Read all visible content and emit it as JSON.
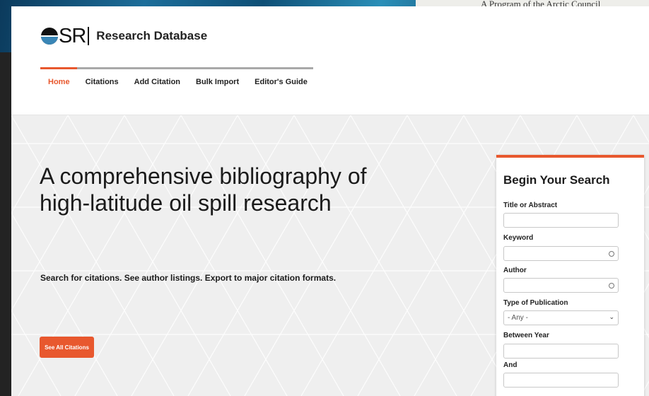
{
  "banner": {
    "tagline": "A Program of the Arctic Council"
  },
  "header": {
    "logo_text": "SR",
    "site_name": "Research Database"
  },
  "nav": {
    "items": [
      "Home",
      "Citations",
      "Add Citation",
      "Bulk Import",
      "Editor's Guide"
    ],
    "active": "Home"
  },
  "hero": {
    "title": "A comprehensive bibliography of high-latitude oil spill research",
    "subtitle": "Search for citations. See author listings. Export to major citation formats.",
    "button_label": "See All Citations"
  },
  "search": {
    "heading": "Begin Your Search",
    "title_label": "Title or Abstract",
    "title_value": "",
    "keyword_label": "Keyword",
    "keyword_value": "",
    "author_label": "Author",
    "author_value": "",
    "type_label": "Type of Publication",
    "type_selected": "- Any -",
    "year_from_label": "Between Year",
    "year_from_value": "",
    "year_to_label": "And",
    "year_to_value": ""
  },
  "colors": {
    "accent": "#e8582e",
    "nav_rule": "#a9a9a9",
    "hero_bg": "#efefef"
  }
}
